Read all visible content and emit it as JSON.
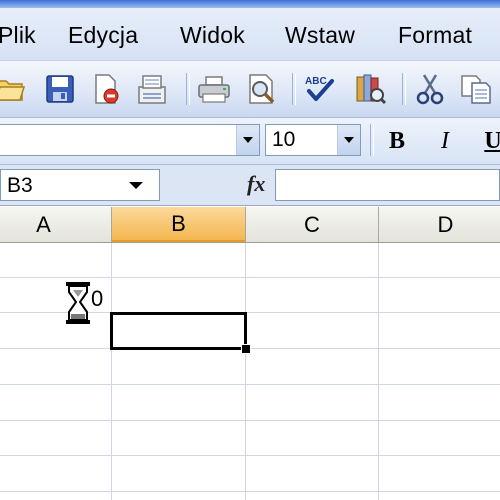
{
  "menu": {
    "items": [
      {
        "label": "Plik"
      },
      {
        "label": "Edycja"
      },
      {
        "label": "Widok"
      },
      {
        "label": "Wstaw"
      },
      {
        "label": "Format"
      }
    ]
  },
  "toolbar": {
    "icons": [
      "open-icon",
      "save-icon",
      "permission-icon",
      "email-icon",
      "print-icon",
      "print-preview-icon",
      "spelling-icon",
      "research-icon",
      "cut-icon",
      "copy-icon"
    ]
  },
  "format": {
    "font_name": "",
    "font_size": "10",
    "bold_label": "B",
    "italic_label": "I",
    "underline_label": "U"
  },
  "formula_bar": {
    "name_box": "B3",
    "fx_label": "fx",
    "formula": ""
  },
  "grid": {
    "columns": [
      "A",
      "B",
      "C",
      "D"
    ],
    "active_column": "B",
    "selected_cell": "B3",
    "cursor_text": "0"
  },
  "colors": {
    "active_header": "#f4b64f",
    "gridline": "#d0d7e5",
    "toolbar_blue": "#d7e3f5"
  }
}
